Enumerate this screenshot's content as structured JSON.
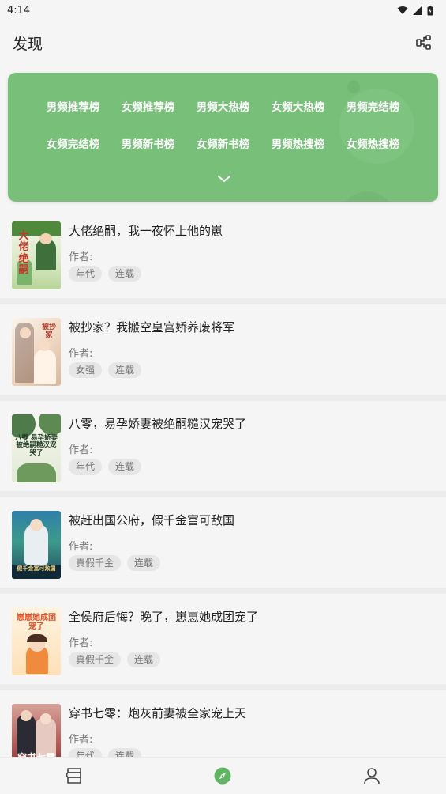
{
  "status_bar": {
    "time": "4:14"
  },
  "app_bar": {
    "title": "发现"
  },
  "ranks": [
    "男频推荐榜",
    "女频推荐榜",
    "男频大热榜",
    "女频大热榜",
    "男频完结榜",
    "女频完结榜",
    "男频新书榜",
    "女频新书榜",
    "男频热搜榜",
    "女频热搜榜"
  ],
  "books": [
    {
      "title": "大佬绝嗣，我一夜怀上他的崽",
      "author_label": "作者:",
      "tags": [
        "年代",
        "连载"
      ],
      "cover_text": "大佬绝嗣"
    },
    {
      "title": "被抄家？我搬空皇宫娇养废将军",
      "author_label": "作者:",
      "tags": [
        "女强",
        "连载"
      ],
      "cover_text": "被抄家"
    },
    {
      "title": "八零，易孕娇妻被绝嗣糙汉宠哭了",
      "author_label": "作者:",
      "tags": [
        "年代",
        "连载"
      ],
      "cover_text": "八零 易孕娇妻被绝嗣糙汉宠哭了"
    },
    {
      "title": "被赶出国公府，假千金富可敌国",
      "author_label": "作者:",
      "tags": [
        "真假千金",
        "连载"
      ],
      "cover_text": "假千金富可敌国"
    },
    {
      "title": "全侯府后悔？晚了，崽崽她成团宠了",
      "author_label": "作者:",
      "tags": [
        "真假千金",
        "连载"
      ],
      "cover_text": "崽崽她成团宠了"
    },
    {
      "title": "穿书七零：炮灰前妻被全家宠上天",
      "author_label": "作者:",
      "tags": [
        "年代",
        "连载"
      ],
      "cover_text": "穿书七零"
    }
  ],
  "colors": {
    "accent": "#78c07a",
    "nav_active": "#5fb562"
  }
}
